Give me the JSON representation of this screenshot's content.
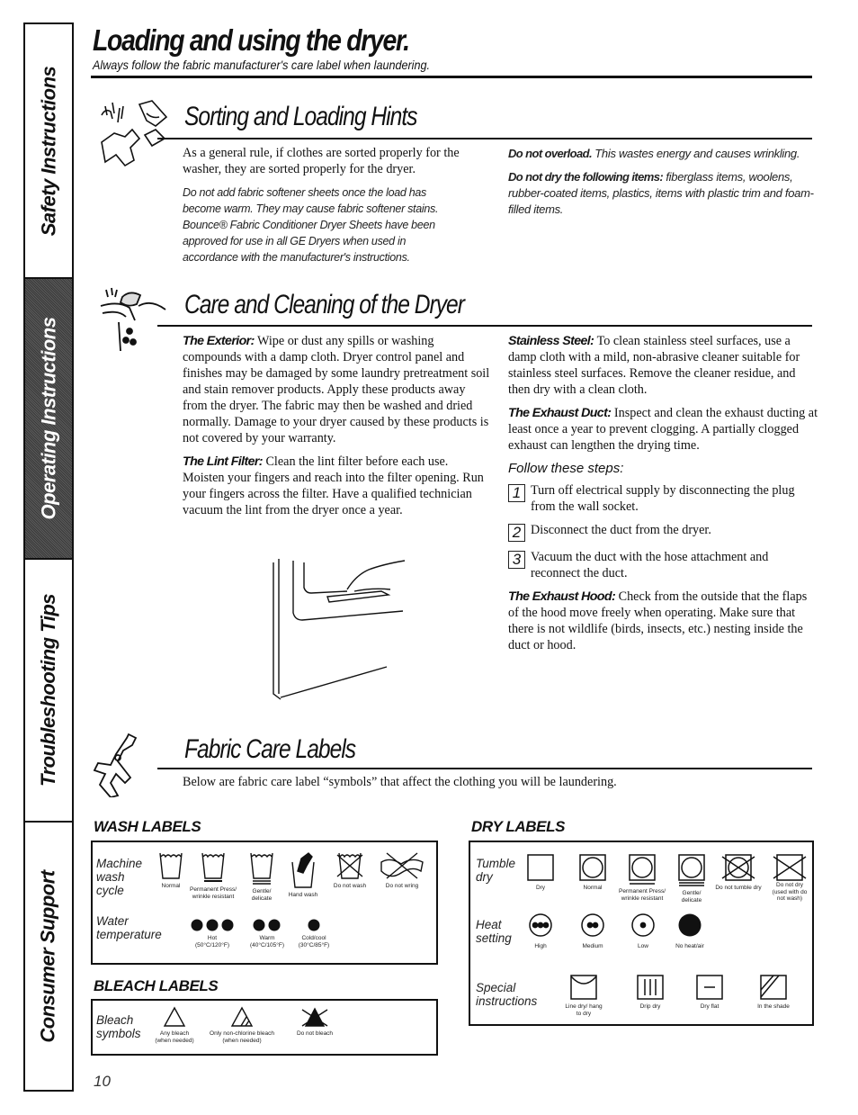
{
  "side_tabs": [
    "Safety Instructions",
    "Operating Instructions",
    "Troubleshooting Tips",
    "Consumer Support"
  ],
  "active_tab": "Operating Instructions",
  "header": {
    "title": "Loading and using the dryer.",
    "subtitle": "Always follow the fabric manufacturer's care label when laundering."
  },
  "sorting": {
    "title": "Sorting and Loading Hints",
    "intro": "As a general rule, if clothes are sorted properly for the washer, they are sorted properly for the dryer.",
    "softener_note": "Do not add fabric softener sheets once the load has become warm. They may cause fabric softener stains. Bounce® Fabric Conditioner Dryer Sheets have been approved for use in all GE Dryers when used in accordance with the manufacturer's instructions.",
    "overload_lead": "Do not overload.",
    "overload_text": " This wastes energy and causes wrinkling.",
    "nodry_lead": "Do not dry the following items:",
    "nodry_text": " fiberglass items, woolens, rubber-coated items, plastics, items with plastic trim and foam-filled items."
  },
  "care": {
    "title": "Care and Cleaning of the Dryer",
    "exterior_lead": "The Exterior:",
    "exterior_text": " Wipe or dust any spills or washing compounds with a damp cloth. Dryer control panel and finishes may be damaged by some laundry pretreatment soil and stain remover products. Apply these products away from the dryer. The fabric may then be washed and dried normally. Damage to your dryer caused by these products is not covered by your warranty.",
    "lint_lead": "The Lint Filter:",
    "lint_text": " Clean the lint filter before each use. Moisten your fingers and reach into the filter opening. Run your fingers across the filter. Have a qualified technician vacuum the lint from the dryer once a year.",
    "steel_lead": "Stainless Steel:",
    "steel_text": " To clean stainless steel surfaces, use a damp cloth with a mild, non-abrasive cleaner suitable for stainless steel surfaces. Remove the cleaner residue, and then dry with a clean cloth.",
    "duct_lead": "The Exhaust Duct:",
    "duct_text": " Inspect and clean the exhaust ducting at least once a year to prevent clogging. A partially clogged exhaust can lengthen the drying time.",
    "follow": "Follow these steps:",
    "steps": [
      {
        "num": "1",
        "text": "Turn off electrical supply by disconnecting the plug from the wall socket."
      },
      {
        "num": "2",
        "text": "Disconnect the duct from the dryer."
      },
      {
        "num": "3",
        "text": "Vacuum the duct with the hose attachment and reconnect the duct."
      }
    ],
    "hood_lead": "The Exhaust Hood:",
    "hood_text": " Check from the outside that the flaps of the hood move freely when operating. Make sure that there is not wildlife (birds, insects, etc.) nesting inside the duct or hood."
  },
  "fabric": {
    "title": "Fabric Care Labels",
    "intro": "Below are fabric care label “symbols” that affect the clothing you will be laundering."
  },
  "wash_labels": {
    "heading": "WASH LABELS",
    "cycle_label": "Machine wash cycle",
    "cycle": [
      "Normal",
      "Permanent Press/ wrinkle resistant",
      "Gentle/ delicate",
      "Hand wash",
      "Do not wash",
      "Do not wring"
    ],
    "temp_label": "Water temperature",
    "temps": [
      {
        "name": "Hot",
        "range": "(50°C/120°F)",
        "dots": 3
      },
      {
        "name": "Warm",
        "range": "(40°C/105°F)",
        "dots": 2
      },
      {
        "name": "Cold/cool",
        "range": "(30°C/85°F)",
        "dots": 1
      }
    ]
  },
  "bleach_labels": {
    "heading": "BLEACH LABELS",
    "row_label": "Bleach symbols",
    "items": [
      "Any bleach (when needed)",
      "Only non-chlorine bleach (when needed)",
      "Do not bleach"
    ]
  },
  "dry_labels": {
    "heading": "DRY LABELS",
    "tumble_label": "Tumble dry",
    "tumble": [
      "Dry",
      "Normal",
      "Permanent Press/ wrinkle resistant",
      "Gentle/ delicate",
      "Do not tumble dry",
      "Do not dry (used with do not wash)"
    ],
    "heat_label": "Heat setting",
    "heat": [
      "High",
      "Medium",
      "Low",
      "No heat/air"
    ],
    "special_label": "Special instructions",
    "special": [
      "Line dry/ hang to dry",
      "Drip dry",
      "Dry flat",
      "In the shade"
    ]
  },
  "page_number": "10"
}
